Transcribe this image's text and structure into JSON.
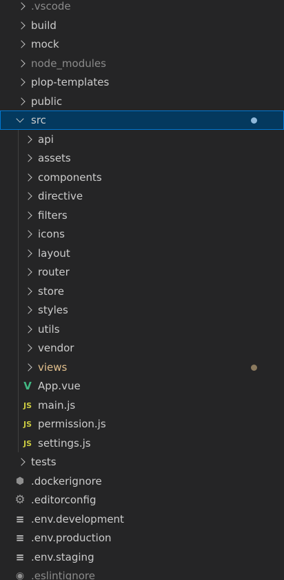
{
  "explorer": {
    "items": [
      {
        "label": ".vscode",
        "kind": "folder",
        "level": 0,
        "dim": true
      },
      {
        "label": "build",
        "kind": "folder",
        "level": 0
      },
      {
        "label": "mock",
        "kind": "folder",
        "level": 0
      },
      {
        "label": "node_modules",
        "kind": "folder",
        "level": 0,
        "dim": true
      },
      {
        "label": "plop-templates",
        "kind": "folder",
        "level": 0
      },
      {
        "label": "public",
        "kind": "folder",
        "level": 0
      },
      {
        "label": "src",
        "kind": "folder-open",
        "level": 0,
        "selected": true,
        "badge": "blue"
      },
      {
        "label": "api",
        "kind": "folder",
        "level": 1
      },
      {
        "label": "assets",
        "kind": "folder",
        "level": 1
      },
      {
        "label": "components",
        "kind": "folder",
        "level": 1
      },
      {
        "label": "directive",
        "kind": "folder",
        "level": 1
      },
      {
        "label": "filters",
        "kind": "folder",
        "level": 1
      },
      {
        "label": "icons",
        "kind": "folder",
        "level": 1
      },
      {
        "label": "layout",
        "kind": "folder",
        "level": 1
      },
      {
        "label": "router",
        "kind": "folder",
        "level": 1
      },
      {
        "label": "store",
        "kind": "folder",
        "level": 1
      },
      {
        "label": "styles",
        "kind": "folder",
        "level": 1
      },
      {
        "label": "utils",
        "kind": "folder",
        "level": 1
      },
      {
        "label": "vendor",
        "kind": "folder",
        "level": 1
      },
      {
        "label": "views",
        "kind": "folder",
        "level": 1,
        "modified": true,
        "badge": "brown"
      },
      {
        "label": "App.vue",
        "kind": "vue",
        "level": 1,
        "icon_text": "V"
      },
      {
        "label": "main.js",
        "kind": "js",
        "level": 1,
        "icon_text": "JS"
      },
      {
        "label": "permission.js",
        "kind": "js",
        "level": 1,
        "icon_text": "JS"
      },
      {
        "label": "settings.js",
        "kind": "js",
        "level": 1,
        "icon_text": "JS"
      },
      {
        "label": "tests",
        "kind": "folder",
        "level": 0
      },
      {
        "label": ".dockerignore",
        "kind": "docker",
        "level": 0,
        "icon_text": "⬢"
      },
      {
        "label": ".editorconfig",
        "kind": "gear",
        "level": 0,
        "icon_text": "⚙"
      },
      {
        "label": ".env.development",
        "kind": "lines",
        "level": 0,
        "icon_text": "≡"
      },
      {
        "label": ".env.production",
        "kind": "lines",
        "level": 0,
        "icon_text": "≡"
      },
      {
        "label": ".env.staging",
        "kind": "lines",
        "level": 0,
        "icon_text": "≡"
      },
      {
        "label": ".eslintignore",
        "kind": "eslint",
        "level": 0,
        "icon_text": "◉",
        "dim": true
      }
    ],
    "colors": {
      "background": "#252526",
      "selected_bg": "#04395e",
      "selected_border": "#0078d4",
      "modified_text": "#e2c08d",
      "js_icon": "#cbcb41",
      "vue_icon": "#41b883"
    }
  }
}
